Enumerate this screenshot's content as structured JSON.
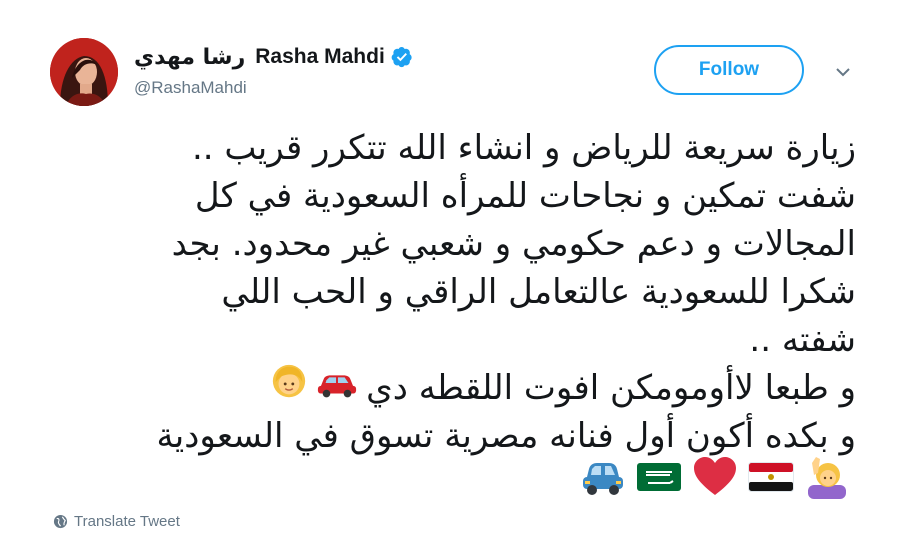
{
  "user": {
    "name_arabic": "رشا مهدي",
    "name_english": "Rasha Mahdi",
    "handle": "@RashaMahdi",
    "verified_icon": "verified-badge-icon"
  },
  "follow_label": "Follow",
  "tweet": {
    "lines": [
      "زيارة سريعة للرياض و انشاء الله تتكرر قريب ..",
      "شفت تمكين و نجاحات للمرأه السعودية في كل",
      "المجالات و دعم حكومي و شعبي غير محدود. بجد",
      "شكرا للسعودية عالتعامل الراقي و الحب اللي",
      "شفته ..",
      "و طبعا لاأومومكن افوت اللقطه دي",
      "و بكده أكون أول فنانه مصرية تسوق في السعودية"
    ],
    "line6_emojis": [
      "red-car-emoji",
      "woman-blond-emoji"
    ],
    "emoji_row": [
      "blue-car-emoji",
      "saudi-flag-emoji",
      "red-heart-emoji",
      "egypt-flag-emoji",
      "woman-raising-hand-emoji"
    ]
  },
  "translate_label": "Translate Tweet",
  "colors": {
    "accent": "#1da1f2",
    "text": "#14171a",
    "muted": "#657786"
  }
}
